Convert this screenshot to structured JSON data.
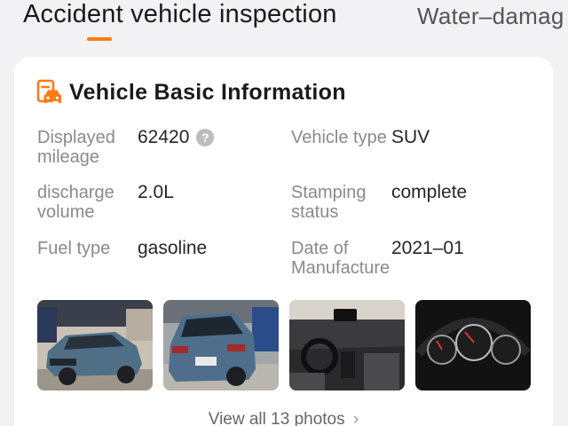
{
  "tabs": {
    "active": "Accident vehicle inspection",
    "inactive": "Water–damag",
    "accent_color": "#ff7a18"
  },
  "card": {
    "title": "Vehicle Basic Information",
    "icon": "car-document-icon",
    "fields": {
      "mileage_label": "Displayed mileage",
      "mileage_value": "62420",
      "type_label": "Vehicle type",
      "type_value": "SUV",
      "discharge_label": "discharge volume",
      "discharge_value": "2.0L",
      "stamping_label": "Stamping status",
      "stamping_value": "complete",
      "fuel_label": "Fuel type",
      "fuel_value": "gasoline",
      "date_label": "Date of Manufacture",
      "date_value": "2021–01"
    },
    "help_icon": "question-circle-icon",
    "photos": [
      "car-front-photo",
      "car-rear-photo",
      "car-interior-photo",
      "car-dashboard-photo"
    ],
    "view_all": "View all 13 photos",
    "view_all_icon": "chevron-right-icon"
  }
}
